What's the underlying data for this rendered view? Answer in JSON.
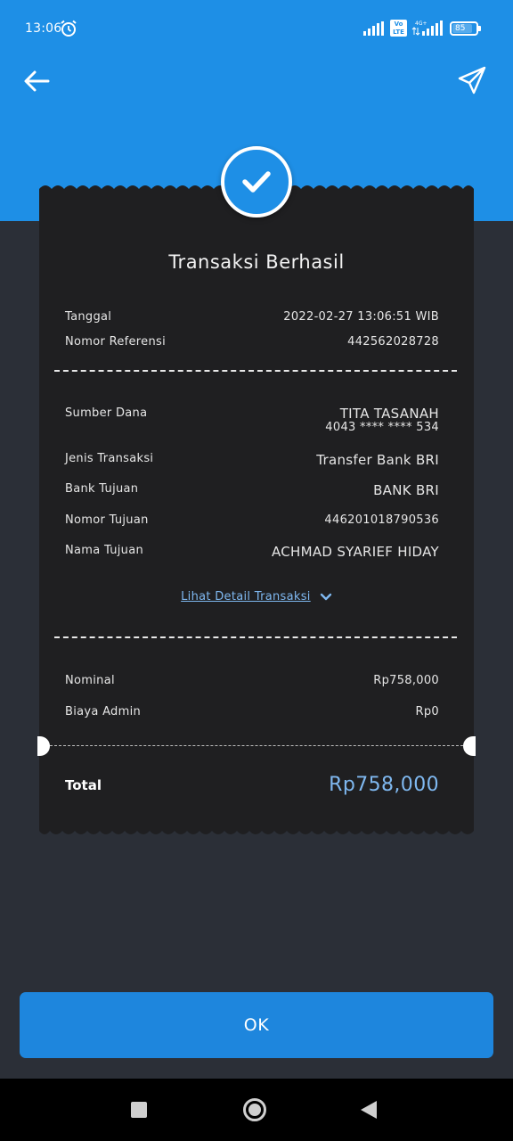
{
  "status_bar": {
    "time": "13:06",
    "volte": "Vo\nLTE",
    "battery": "85",
    "battery_level": 0.85,
    "network": "4G+"
  },
  "header": {
    "back_icon": "arrow-left-icon",
    "share_icon": "send-icon"
  },
  "receipt": {
    "title": "Transaksi Berhasil",
    "meta": [
      {
        "label": "Tanggal",
        "value": "2022-02-27 13:06:51 WIB"
      },
      {
        "label": "Nomor Referensi",
        "value": "442562028728"
      }
    ],
    "details": {
      "source_label": "Sumber Dana",
      "source_name": "TITA TASANAH",
      "source_account": "4043 **** **** 534",
      "type_label": "Jenis Transaksi",
      "type_value": "Transfer Bank BRI",
      "bank_label": "Bank Tujuan",
      "bank_value": "BANK BRI",
      "dest_number_label": "Nomor Tujuan",
      "dest_number_value": "446201018790536",
      "dest_name_label": "Nama Tujuan",
      "dest_name_value": "ACHMAD SYARIEF HIDAY"
    },
    "detail_link": "Lihat Detail Transaksi",
    "amounts": {
      "nominal_label": "Nominal",
      "nominal_value": "Rp758,000",
      "admin_label": "Biaya Admin",
      "admin_value": "Rp0"
    },
    "total_label": "Total",
    "total_value": "Rp758,000"
  },
  "ok_button": "OK",
  "colors": {
    "accent": "#1e8fe6",
    "background": "#2b2f37",
    "receipt": "#1f1f21",
    "link": "#7fb8f0"
  }
}
